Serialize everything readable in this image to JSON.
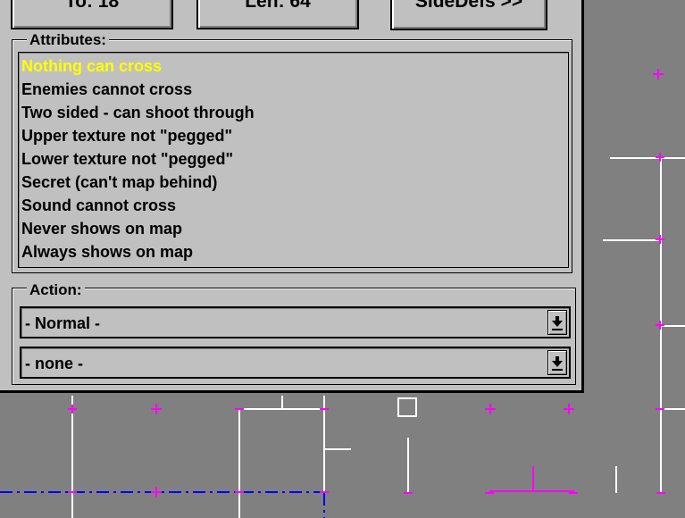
{
  "top_buttons": {
    "to_label": "To: 18",
    "length_label": "Len: 64",
    "sidedefs_label": "SideDefs >>"
  },
  "attributes": {
    "title": "Attributes:",
    "items": [
      {
        "label": "Nothing can cross",
        "selected": true
      },
      {
        "label": "Enemies cannot cross",
        "selected": false
      },
      {
        "label": "Two sided - can shoot through",
        "selected": false
      },
      {
        "label": "Upper texture not \"pegged\"",
        "selected": false
      },
      {
        "label": "Lower texture not \"pegged\"",
        "selected": false
      },
      {
        "label": "Secret (can't map behind)",
        "selected": false
      },
      {
        "label": "Sound cannot cross",
        "selected": false
      },
      {
        "label": "Never shows on map",
        "selected": false
      },
      {
        "label": "Always shows on map",
        "selected": false
      }
    ]
  },
  "action": {
    "title": "Action:",
    "type_value": "- Normal -",
    "tag_value": "- none -"
  },
  "colors": {
    "panel": "#c0c0c0",
    "map_background": "#808080",
    "wall": "#ffffff",
    "vertex": "#ff00ff",
    "selected_line": "#0000ff",
    "selected_text": "#ffff00"
  }
}
